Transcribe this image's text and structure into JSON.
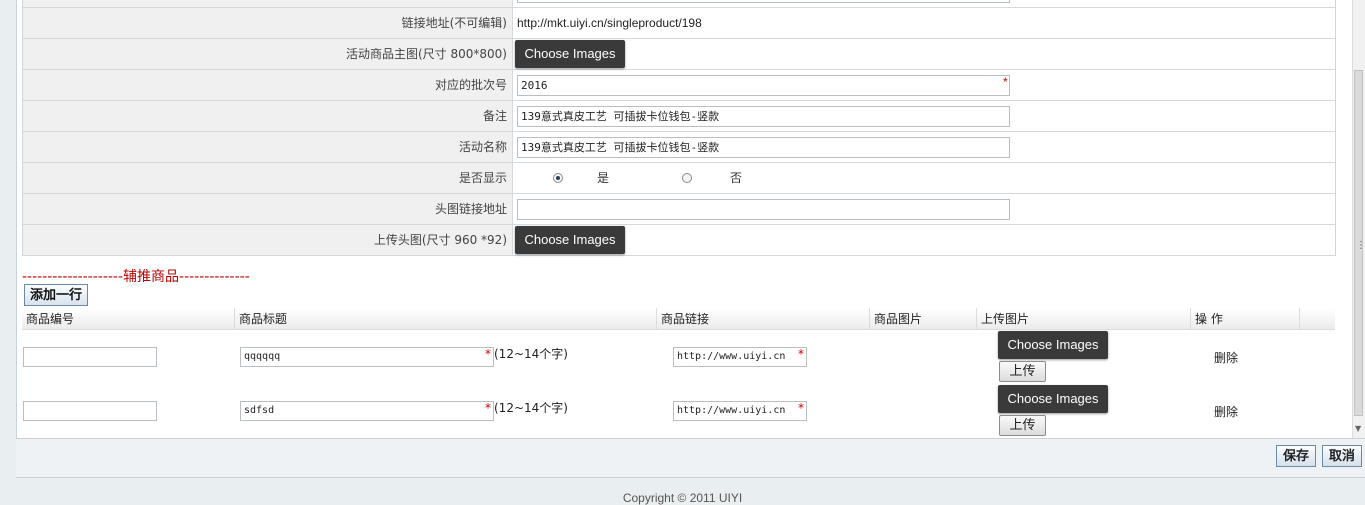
{
  "form": {
    "link_label": "链接地址(不可编辑)",
    "link_value": "http://mkt.uiyi.cn/singleproduct/198",
    "main_image_label": "活动商品主图(尺寸 800*800)",
    "choose_images": "Choose Images",
    "batch_label": "对应的批次号",
    "batch_value": "2016",
    "remark_label": "备注",
    "remark_value": "139意式真皮工艺 可插拔卡位钱包-竖款",
    "activity_label": "活动名称",
    "activity_value": "139意式真皮工艺 可插拔卡位钱包-竖款",
    "display_label": "是否显示",
    "display_yes": "是",
    "display_no": "否",
    "display_selected": "是",
    "head_link_label": "头图链接地址",
    "head_link_value": "",
    "head_image_label": "上传头图(尺寸 960 *92)",
    "required_mark": "*"
  },
  "section": {
    "title": "--------------------辅推商品--------------",
    "add_row": "添加一行"
  },
  "table": {
    "headers": [
      "商品编号",
      "商品标题",
      "商品链接",
      "商品图片",
      "上传图片",
      "操 作"
    ],
    "rows": [
      {
        "code": "",
        "title": "qqqqqq",
        "hint": "(12~14个字)",
        "link": "http://www.uiyi.cn",
        "choose": "Choose Images",
        "upload": "上传",
        "delete": "删除"
      },
      {
        "code": "",
        "title": "sdfsd",
        "hint": "(12~14个字)",
        "link": "http://www.uiyi.cn",
        "choose": "Choose Images",
        "upload": "上传",
        "delete": "删除"
      }
    ]
  },
  "footer": {
    "save": "保存",
    "cancel": "取消",
    "copyright": "Copyright © 2011 UIYI"
  }
}
